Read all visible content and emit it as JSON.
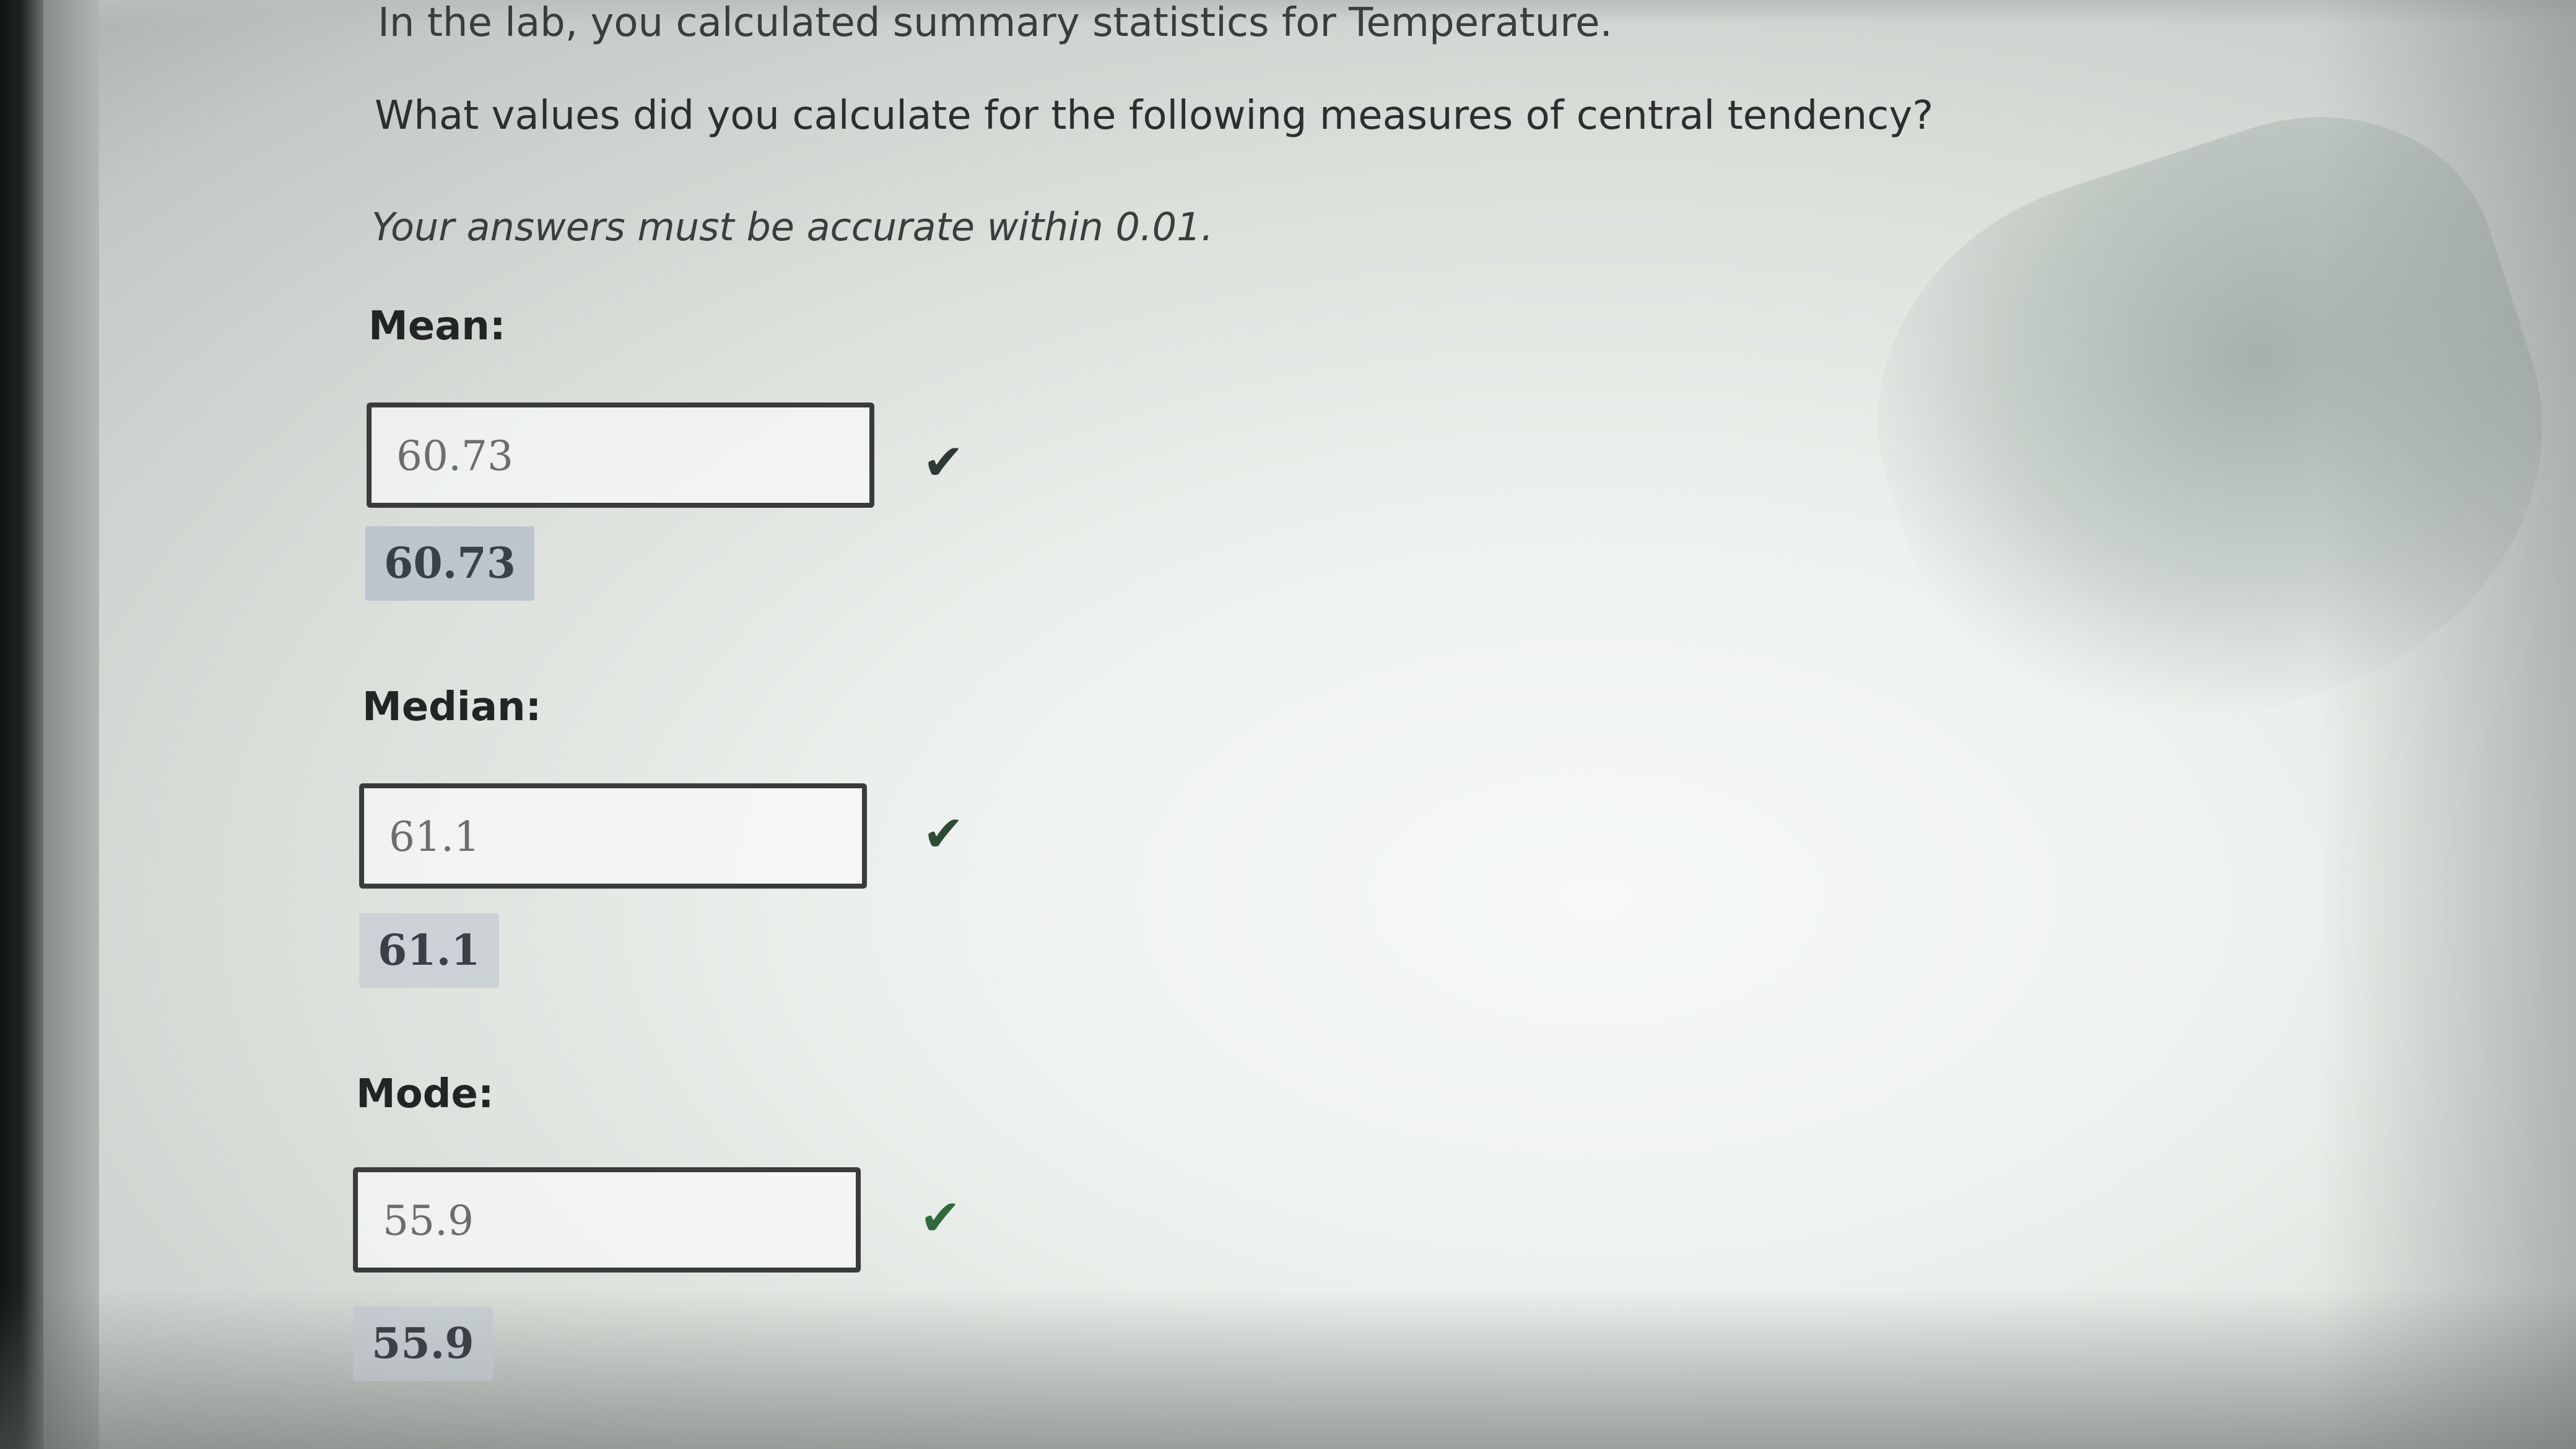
{
  "question": {
    "intro": "In the lab, you calculated summary statistics for Temperature.",
    "prompt": "What values did you calculate for the following measures of central tendency?",
    "accuracy_note": "Your answers must be accurate within 0.01."
  },
  "fields": {
    "mean": {
      "label": "Mean:",
      "value": "60.73",
      "correct_answer": "60.73",
      "check_icon": "checkmark-icon",
      "check_glyph": "✔",
      "check_color": "#2e3a33"
    },
    "median": {
      "label": "Median:",
      "value": "61.1",
      "correct_answer": "61.1",
      "check_icon": "checkmark-icon",
      "check_glyph": "✔",
      "check_color": "#2f4a35"
    },
    "mode": {
      "label": "Mode:",
      "value": "55.9",
      "correct_answer": "55.9",
      "check_icon": "checkmark-icon",
      "check_glyph": "✔",
      "check_color": "#2f6b3c"
    }
  },
  "colors": {
    "chip_background": "#b6bfcb",
    "check_green": "#2f6b3c"
  }
}
